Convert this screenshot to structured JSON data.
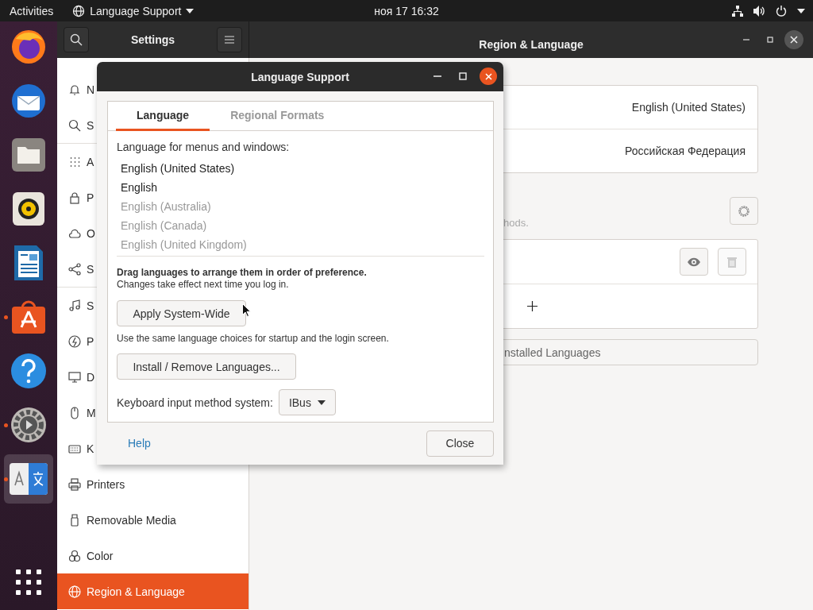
{
  "top_bar": {
    "activities": "Activities",
    "app_menu": "Language Support",
    "clock": "ноя 17  16:32"
  },
  "dock": [
    {
      "kind": "firefox",
      "running": false,
      "selected": false
    },
    {
      "kind": "mail",
      "running": false,
      "selected": false
    },
    {
      "kind": "files",
      "running": false,
      "selected": false
    },
    {
      "kind": "speaker",
      "running": false,
      "selected": false
    },
    {
      "kind": "document",
      "running": false,
      "selected": false
    },
    {
      "kind": "store",
      "running": true,
      "selected": false
    },
    {
      "kind": "help",
      "running": false,
      "selected": false
    },
    {
      "kind": "settings",
      "running": true,
      "selected": false
    },
    {
      "kind": "language",
      "running": true,
      "selected": true
    }
  ],
  "settings": {
    "title": "Settings",
    "page_title": "Region & Language",
    "sidebar_groups": [
      [
        {
          "kind": "bell",
          "label": "N",
          "selected": false
        },
        {
          "kind": "search",
          "label": "S",
          "selected": false
        }
      ],
      [
        {
          "kind": "grid",
          "label": "A",
          "selected": false
        },
        {
          "kind": "lock",
          "label": "P",
          "selected": false
        },
        {
          "kind": "cloud",
          "label": "O",
          "selected": false
        },
        {
          "kind": "share",
          "label": "S",
          "selected": false
        }
      ],
      [
        {
          "kind": "music",
          "label": "S",
          "selected": false
        },
        {
          "kind": "power",
          "label": "P",
          "selected": false
        },
        {
          "kind": "display",
          "label": "D",
          "selected": false
        },
        {
          "kind": "mouse",
          "label": "M",
          "selected": false
        },
        {
          "kind": "keyboard",
          "label": "K",
          "selected": false
        },
        {
          "kind": "printer",
          "label": "Printers",
          "selected": false
        },
        {
          "kind": "drive",
          "label": "Removable Media",
          "selected": false
        },
        {
          "kind": "color",
          "label": "Color",
          "selected": false
        },
        {
          "kind": "globe",
          "label": "Region & Language",
          "selected": true
        }
      ]
    ],
    "formats": [
      {
        "value": "English (United States)"
      },
      {
        "value": "Российская Федерация"
      }
    ],
    "input_hint": "hods.",
    "manage_button": "nstalled Languages"
  },
  "dialog": {
    "title": "Language Support",
    "tabs": [
      {
        "label": "Language",
        "selected": true
      },
      {
        "label": "Regional Formats",
        "selected": false
      }
    ],
    "list_label": "Language for menus and windows:",
    "languages": [
      {
        "name": "English (United States)",
        "dimmed": false
      },
      {
        "name": "English",
        "dimmed": false
      },
      {
        "name": "English (Australia)",
        "dimmed": true
      },
      {
        "name": "English (Canada)",
        "dimmed": true
      },
      {
        "name": "English (United Kingdom)",
        "dimmed": true
      }
    ],
    "drag_hint": "Drag languages to arrange them in order of preference.",
    "changes_note": "Changes take effect next time you log in.",
    "apply_button": "Apply System-Wide",
    "apply_note": "Use the same language choices for startup and the login screen.",
    "install_button": "Install / Remove Languages...",
    "keyboard_label": "Keyboard input method system:",
    "keyboard_value": "IBus",
    "help": "Help",
    "close": "Close"
  }
}
